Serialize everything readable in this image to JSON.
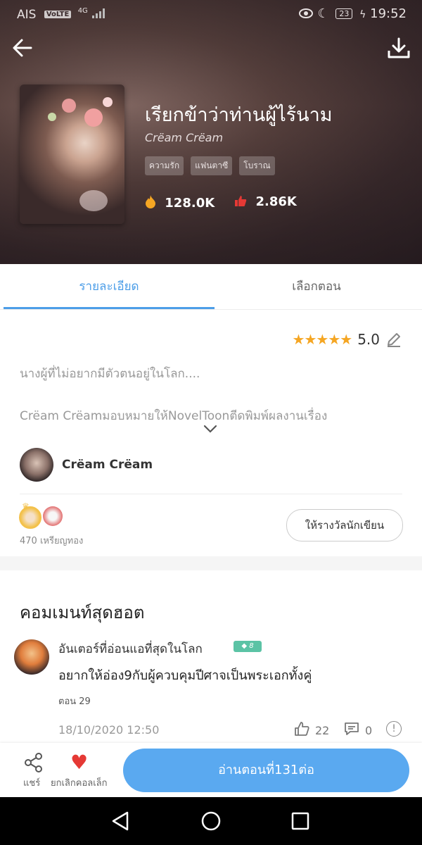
{
  "status_bar": {
    "carrier": "AIS",
    "volte": "VoLTE",
    "network": "4G",
    "battery": "23",
    "time": "19:52"
  },
  "header": {
    "back_icon": "arrow-left-icon",
    "download_icon": "download-icon",
    "title": "เรียกข้าว่าท่านผู้ไร้นาม",
    "author": "Crëam Crëam",
    "tags": [
      "ความรัก",
      "แฟนตาซี",
      "โบราณ"
    ],
    "views": "128.0K",
    "likes": "2.86K",
    "colors": {
      "fire": "#f5a623",
      "like": "#e53935"
    }
  },
  "tabs": [
    {
      "label": "รายละเอียด",
      "active": true
    },
    {
      "label": "เลือกตอน",
      "active": false
    }
  ],
  "details": {
    "rating": "5.0",
    "stars": "★★★★★",
    "description": "นางผู้ที่ไม่อยากมีตัวตนอยู่ในโลก....",
    "license": "Crëam Crëamมอบหมายให้NovelToonตีดพิมพ์ผลงานเรื่อง",
    "author_name": "Crëam Crëam",
    "coins": "470 เหรียญทอง",
    "reward_button": "ให้รางวัลนักเขียน"
  },
  "comments": {
    "section_title": "คอมเมนท์สุดฮอต",
    "items": [
      {
        "user": "อันเตอร์ที่อ่อนแอที่สุดในโลก",
        "level": "8",
        "text": "อยากให้อ่อง9กับผู้ควบคุมปีศาจเป็นพระเอกทั้งคู่",
        "episode": "ตอน 29",
        "date": "18/10/2020 12:50",
        "likes": "22",
        "replies": "0"
      }
    ]
  },
  "bottom_bar": {
    "share_label": "แชร์",
    "uncollect_label": "ยกเลิกคอลเล็ก",
    "read_button": "อ่านตอนที่131ต่อ",
    "accent": "#5aa9f0"
  },
  "nav": {
    "back_icon": "nav-back-icon",
    "home_icon": "nav-home-icon",
    "recent_icon": "nav-recent-icon"
  }
}
